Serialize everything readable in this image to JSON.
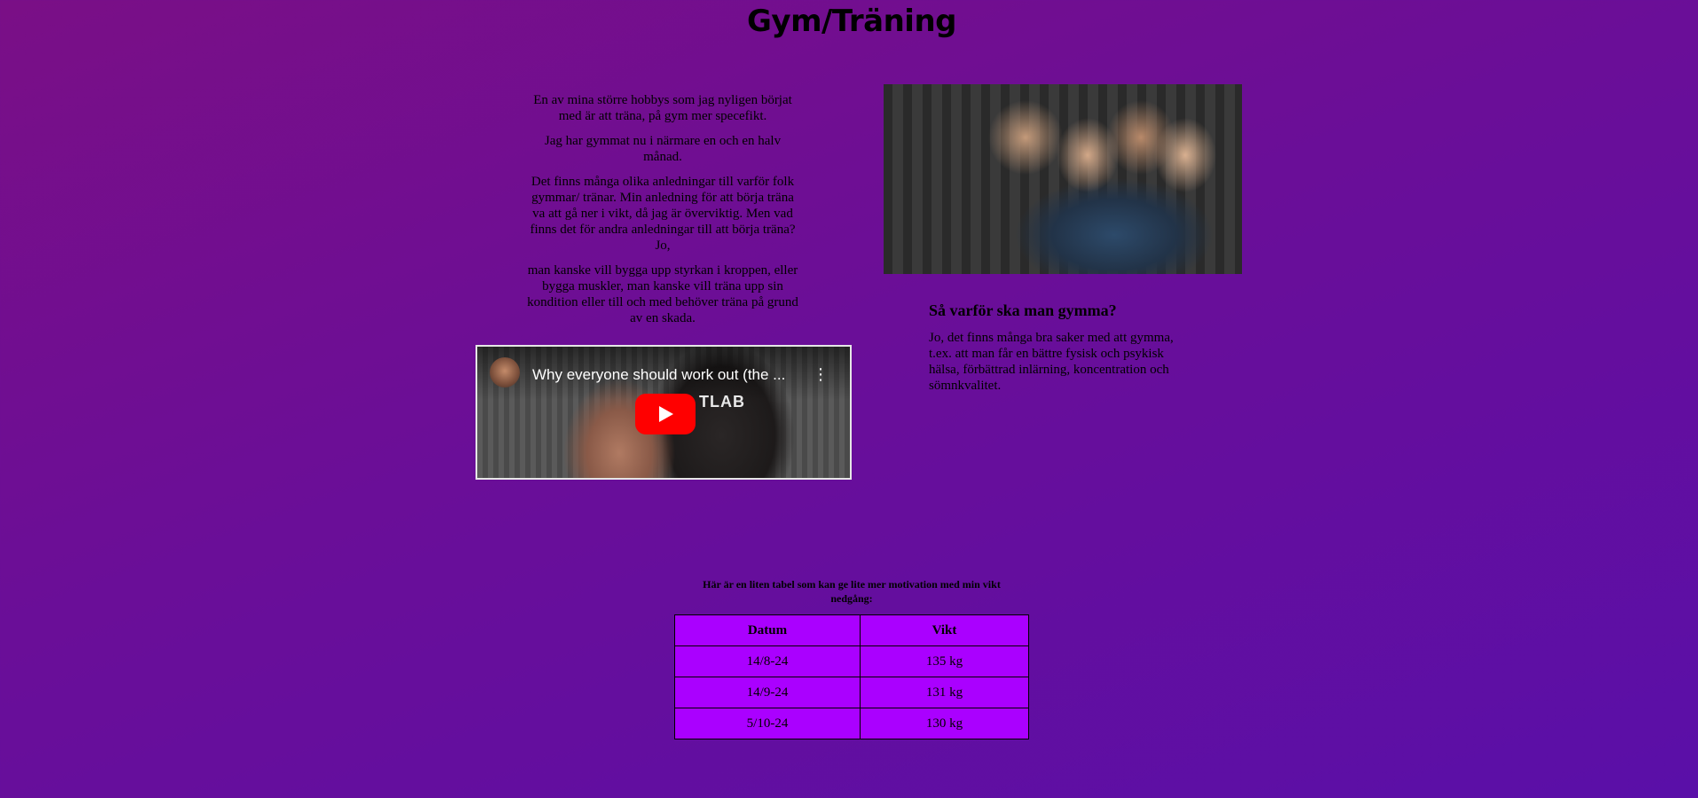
{
  "page": {
    "title": "Gym/Träning"
  },
  "intro": {
    "paragraphs": [
      "En av mina större hobbys som jag nyligen börjat med är att träna, på gym mer specefikt.",
      "Jag har gymmat nu i närmare en och en halv månad.",
      "Det finns många olika anledningar till varför folk gymmar/ tränar. Min anledning för att börja träna va att gå ner i vikt, då jag är överviktig. Men vad finns det för andra anledningar till att börja träna? Jo,",
      "man kanske vill bygga upp styrkan i kroppen, eller bygga muskler, man kanske vill träna upp sin kondition eller till och med behöver träna på grund av en skada."
    ]
  },
  "video": {
    "title": "Why everyone should work out (the ...",
    "brand": "TLAB",
    "menu_icon": "more-vert-icon",
    "play_icon": "youtube-play-icon",
    "play_color": "#ff0000"
  },
  "reasons": {
    "heading": "Så varför ska man gymma?",
    "text": "Jo, det finns många bra saker med att gymma, t.ex. att man får en bättre fysisk och psykisk hälsa, förbättrad inlärning, koncentration och sömnkvalitet."
  },
  "weight_table": {
    "caption": "Här är en liten tabel som kan ge lite mer motivation med min vikt nedgång:",
    "headers": [
      "Datum",
      "Vikt"
    ],
    "rows": [
      [
        "14/8-24",
        "135 kg"
      ],
      [
        "14/9-24",
        "131 kg"
      ],
      [
        "5/10-24",
        "130 kg"
      ]
    ],
    "background": "#aa00ff"
  },
  "colors": {
    "background_start": "#7a0f86",
    "background_end": "#5a0fa8"
  }
}
